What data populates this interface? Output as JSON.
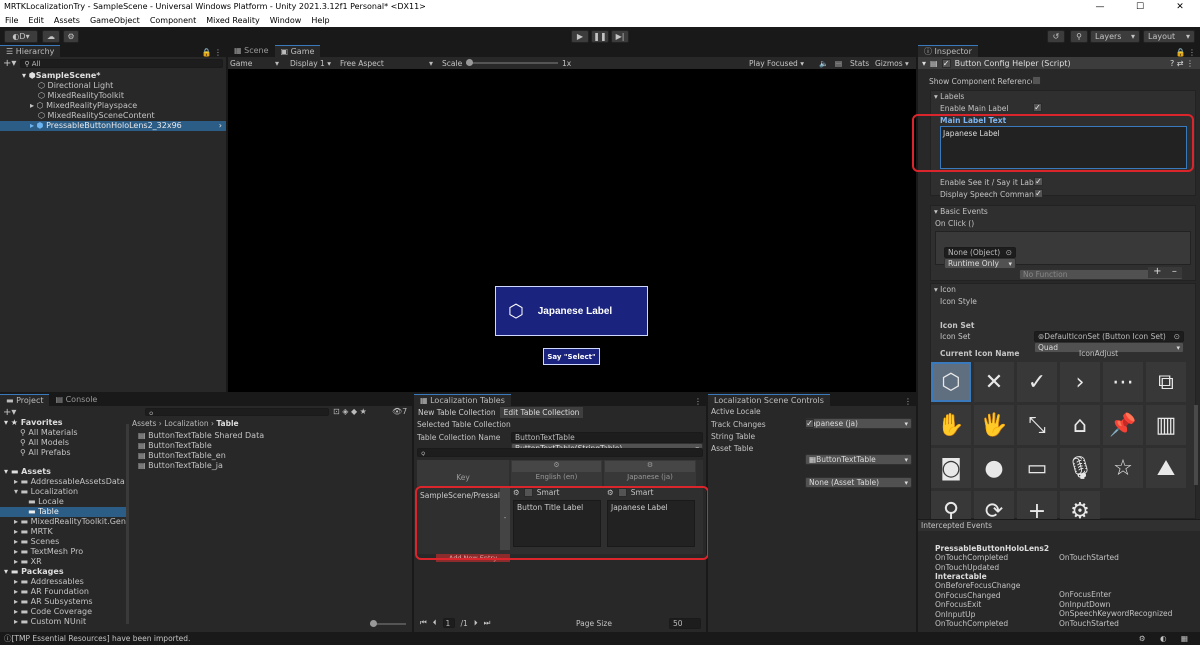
{
  "window": {
    "title": "MRTKLocalizationTry - SampleScene - Universal Windows Platform - Unity 2021.3.12f1 Personal* <DX11>"
  },
  "menu": [
    "File",
    "Edit",
    "Assets",
    "GameObject",
    "Component",
    "Mixed Reality",
    "Window",
    "Help"
  ],
  "toolbar": {
    "account": "D",
    "layers": "Layers",
    "layout": "Layout"
  },
  "hierarchy": {
    "tab": "Hierarchy",
    "search_placeholder": "All",
    "scene": "SampleScene*",
    "items": [
      "Directional Light",
      "MixedRealityToolkit",
      "MixedRealityPlayspace",
      "MixedRealitySceneContent",
      "PressableButtonHoloLens2_32x96"
    ]
  },
  "game_view": {
    "tabs": [
      "Scene",
      "Game"
    ],
    "display_mode": "Game",
    "display": "Display 1",
    "aspect": "Free Aspect",
    "scale_label": "Scale",
    "scale_value": "1x",
    "play_focused": "Play Focused",
    "stats": "Stats",
    "gizmos": "Gizmos",
    "button_label": "Japanese Label",
    "say_label": "Say \"Select\""
  },
  "project": {
    "tabs": [
      "Project",
      "Console"
    ],
    "count": "7",
    "favorites": "Favorites",
    "fav_items": [
      "All Materials",
      "All Models",
      "All Prefabs"
    ],
    "assets": "Assets",
    "asset_items": [
      "AddressableAssetsData",
      "Localization",
      "Locale",
      "Table",
      "MixedRealityToolkit.Gene",
      "MRTK",
      "Scenes",
      "TextMesh Pro",
      "XR"
    ],
    "packages": "Packages",
    "package_items": [
      "Addressables",
      "AR Foundation",
      "AR Subsystems",
      "Code Coverage",
      "Custom NUnit"
    ],
    "breadcrumb": [
      "Assets",
      "Localization",
      "Table"
    ],
    "files": [
      "ButtonTextTable Shared Data",
      "ButtonTextTable",
      "ButtonTextTable_en",
      "ButtonTextTable_ja"
    ]
  },
  "localization_tables": {
    "tab": "Localization Tables",
    "new_collection": "New Table Collection",
    "edit_collection": "Edit Table Collection",
    "selected_label": "Selected Table Collection",
    "selected_value": "ButtonTextTable(StringTable)",
    "name_label": "Table Collection Name",
    "name_value": "ButtonTextTable",
    "col_key": "Key",
    "col_en": "English (en)",
    "col_ja": "Japanese (ja)",
    "key_value": "SampleScene/Pressal",
    "smart": "Smart",
    "en_value": "Button Title Label",
    "ja_value": "Japanese Label",
    "add_entry": "Add New Entry",
    "page_current": "1",
    "page_total": "/1",
    "page_size_label": "Page Size",
    "page_size_value": "50"
  },
  "scene_controls": {
    "tab": "Localization Scene Controls",
    "active_locale_label": "Active Locale",
    "active_locale_value": "Japanese (ja)",
    "track_changes_label": "Track Changes",
    "string_table_label": "String Table",
    "string_table_value": "ButtonTextTable",
    "asset_table_label": "Asset Table",
    "asset_table_value": "None (Asset Table)"
  },
  "inspector": {
    "tab": "Inspector",
    "component": "Button Config Helper (Script)",
    "show_ref": "Show Component Reference:",
    "labels_header": "Labels",
    "enable_main_label": "Enable Main Label",
    "main_label_text": "Main Label Text",
    "main_label_value": "Japanese Label",
    "enable_see_it": "Enable See it / Say it Label",
    "display_speech": "Display Speech Command",
    "basic_events": "Basic Events",
    "on_click": "On Click ()",
    "runtime_only": "Runtime Only",
    "no_function": "No Function",
    "none_object": "None (Object)",
    "icon_header": "Icon",
    "icon_style_label": "Icon Style",
    "icon_style_value": "Quad",
    "icon_set_header": "Icon Set",
    "icon_set_label": "Icon Set",
    "icon_set_value": "DefaultIconSet (Button Icon Set)",
    "current_icon_name": "Current Icon Name",
    "icon_adjust": "IconAdjust",
    "intercepted": "Intercepted Events",
    "events": {
      "group1": "PressableButtonHoloLens2",
      "g1_left": [
        "OnTouchCompleted",
        "OnTouchUpdated"
      ],
      "g1_right": [
        "OnTouchStarted"
      ],
      "group2": "Interactable",
      "g2_left": [
        "OnBeforeFocusChange",
        "OnFocusChanged",
        "OnFocusExit",
        "OnInputUp",
        "OnTouchCompleted"
      ],
      "g2_right": [
        "OnFocusEnter",
        "OnInputDown",
        "OnSpeechKeywordRecognized",
        "OnTouchStarted"
      ]
    }
  },
  "status": {
    "message": "[TMP Essential Resources] have been imported."
  }
}
